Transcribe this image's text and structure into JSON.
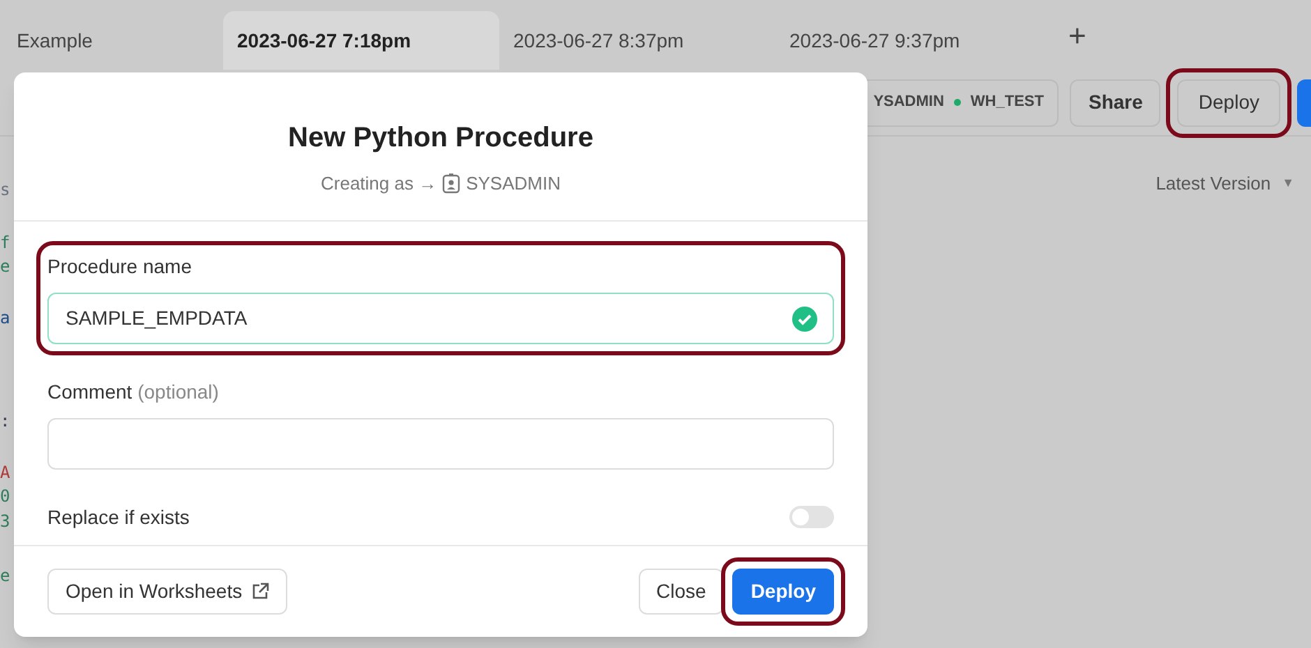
{
  "tabs": [
    {
      "label": "Example",
      "selected": false
    },
    {
      "label": "2023-06-27 7:18pm",
      "selected": true
    },
    {
      "label": "2023-06-27 8:37pm",
      "selected": false
    },
    {
      "label": "2023-06-27 9:37pm",
      "selected": false
    }
  ],
  "add_tab": "+",
  "toolbar": {
    "role": "YSADMIN",
    "warehouse": "WH_TEST",
    "share": "Share",
    "deploy": {
      "label": "Deploy",
      "highlighted": true
    }
  },
  "version_select": "Latest Version",
  "version_caret": "▼",
  "code_fragments": [
    {
      "text": "s",
      "color": "#6b7280"
    },
    {
      "text": "f",
      "color": "#2e7d5b"
    },
    {
      "text": "e",
      "color": "#2e7d5b"
    },
    {
      "text": "a",
      "color": "#1f4e8c"
    },
    {
      "text": ":",
      "color": "#374151"
    },
    {
      "text": "A",
      "color": "#b03a3a"
    },
    {
      "text": "0",
      "color": "#2e7d5b"
    },
    {
      "text": "3",
      "color": "#2e7d5b"
    },
    {
      "text": "e",
      "color": "#2e7d5b"
    }
  ],
  "dialog": {
    "title": "New Python Procedure",
    "subtitle": "Creating as →",
    "role": "SYSADMIN",
    "fields": [
      {
        "label": "Procedure name",
        "value": "SAMPLE_EMPDATA",
        "valid": true,
        "highlighted": true
      },
      {
        "label": "Comment",
        "hint": "(optional)",
        "valid": false,
        "highlighted": false
      }
    ],
    "replace_if_exists": {
      "label": "Replace if exists",
      "on": false
    },
    "open_in_worksheets": "Open in Worksheets",
    "close": "Close",
    "deploy": {
      "label": "Deploy",
      "highlighted": true
    }
  }
}
